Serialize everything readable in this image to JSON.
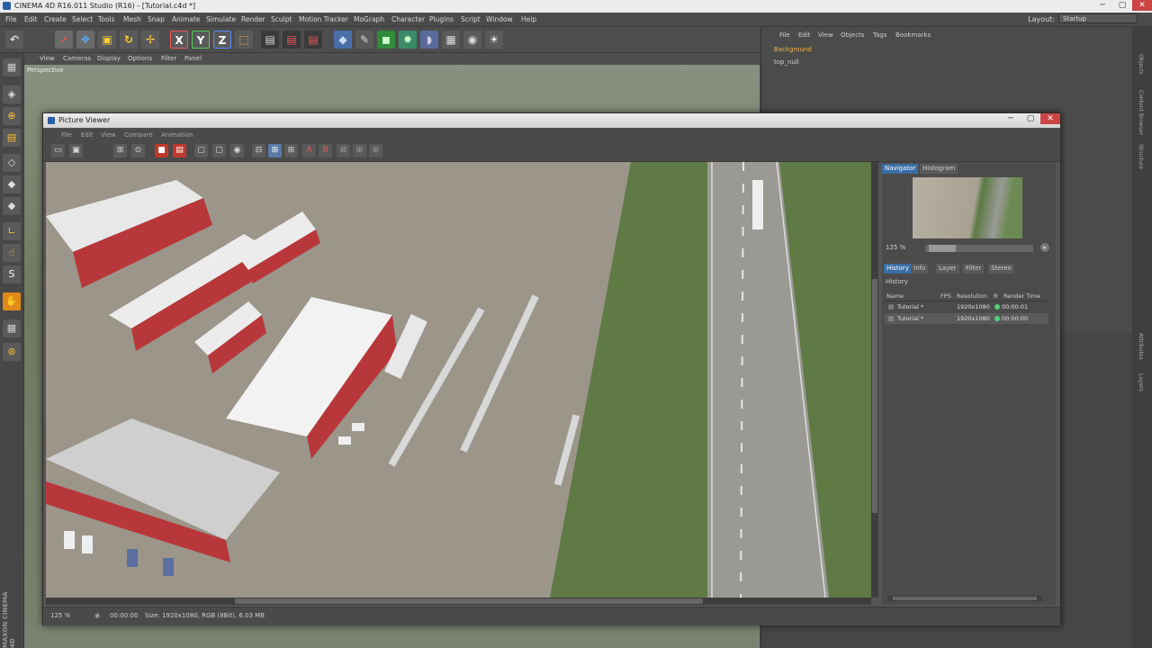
{
  "app": {
    "title": "CINEMA 4D R16.011 Studio (R16) - [Tutorial.c4d *]",
    "layout_label": "Layout:",
    "layout_value": "Startup",
    "menu": [
      "File",
      "Edit",
      "Create",
      "Select",
      "Tools",
      "Mesh",
      "Snap",
      "Animate",
      "Simulate",
      "Render",
      "Sculpt",
      "Motion Tracker",
      "MoGraph",
      "Character",
      "Plugins",
      "Script",
      "Window",
      "Help"
    ]
  },
  "viewport": {
    "menu": [
      "View",
      "Cameras",
      "Display",
      "Options",
      "Filter",
      "Panel"
    ],
    "label": "Perspective"
  },
  "object_manager": {
    "menu": [
      "File",
      "Edit",
      "View",
      "Objects",
      "Tags",
      "Bookmarks"
    ],
    "objects": [
      "Background",
      "top_null"
    ]
  },
  "side_tabs": [
    "Objects",
    "Content Browser",
    "Structure",
    "Attributes",
    "Layers"
  ],
  "picture_viewer": {
    "title": "Picture Viewer",
    "menu": [
      "File",
      "Edit",
      "View",
      "Compare",
      "Animation"
    ],
    "status": {
      "zoom": "125 %",
      "time": "00:00:00",
      "size": "Size: 1920x1080, RGB (8Bit), 6.03 MB"
    },
    "nav_tabs": [
      "Navigator",
      "Histogram"
    ],
    "nav_zoom": "125 %",
    "tabs": [
      "History",
      "Info",
      "Layer",
      "Filter",
      "Stereo"
    ],
    "history_title": "History",
    "history_columns": [
      "Name",
      "FPS",
      "Resolution",
      "R",
      "Render Time"
    ],
    "history_rows": [
      {
        "name": "Tutorial *",
        "resolution": "1920x1080",
        "time": "00:00:01"
      },
      {
        "name": "Tutorial *",
        "resolution": "1920x1080",
        "time": "00:00:00"
      }
    ]
  },
  "logo": "MAXON CINEMA 4D",
  "colors": {
    "accent": "#3a6ea5",
    "status_green": "#4fd07a"
  }
}
